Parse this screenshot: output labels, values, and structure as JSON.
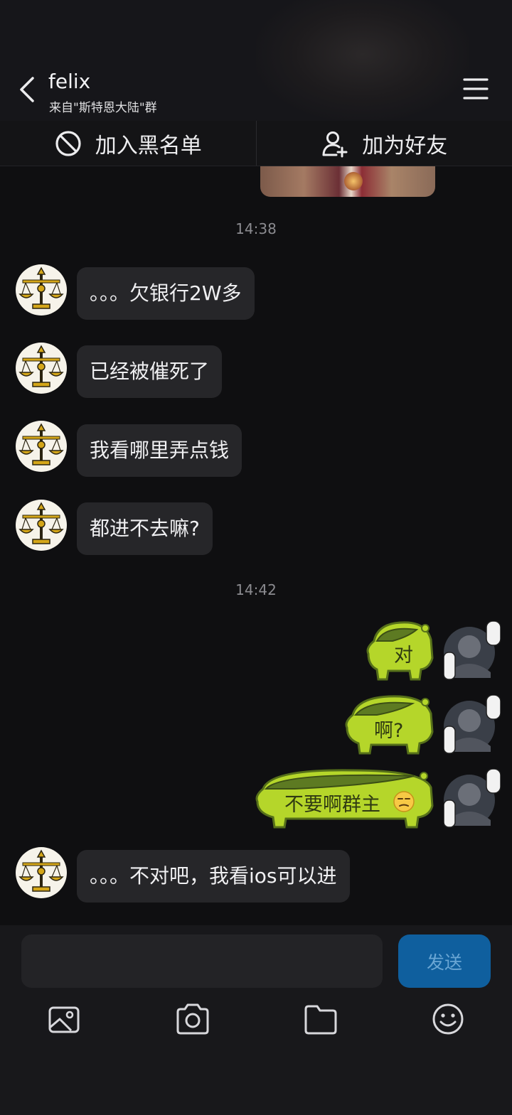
{
  "header": {
    "title": "felix",
    "subtitle": "来自\"斯特恩大陆\"群"
  },
  "actions": {
    "blacklist_label": "加入黑名单",
    "add_friend_label": "加为好友"
  },
  "messages": {
    "time_1": "14:38",
    "msg_1": "。。。欠银行2W多",
    "msg_2": "已经被催死了",
    "msg_3": "我看哪里弄点钱",
    "msg_4": "都进不去嘛?",
    "time_2": "14:42",
    "sticker_1": "对",
    "sticker_2": "啊?",
    "sticker_3": "不要啊群主",
    "msg_5": "。。。不对吧，我看ios可以进"
  },
  "composer": {
    "send_label": "发送",
    "input_value": ""
  },
  "icons": {
    "back": "chevron-left-icon",
    "menu": "menu-icon",
    "blacklist": "block-icon",
    "add_friend": "add-user-icon",
    "image": "image-icon",
    "camera": "camera-icon",
    "folder": "folder-icon",
    "emoji": "emoji-icon"
  },
  "colors": {
    "background": "#0f0f11",
    "bubble": "#262629",
    "send_button": "#0f5f9e",
    "sticker_green": "#b5d62a"
  }
}
